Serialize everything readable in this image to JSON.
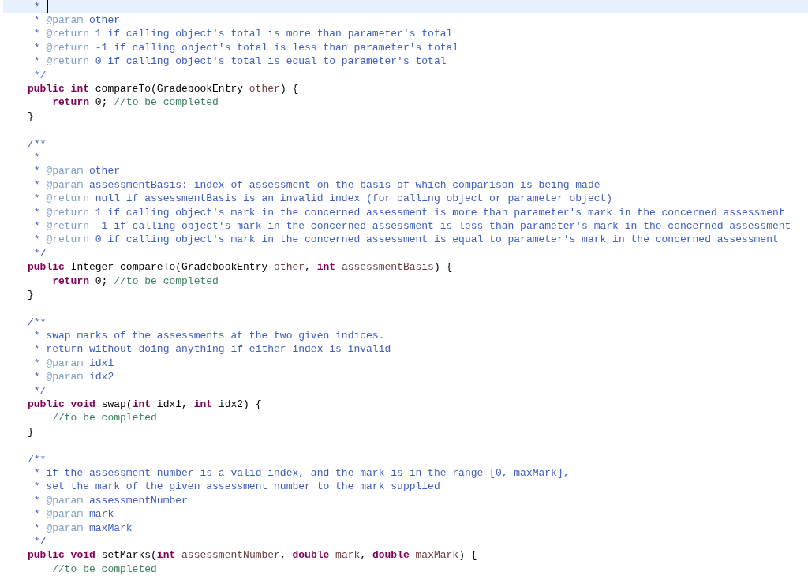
{
  "editor": {
    "lines": [
      {
        "current": true,
        "tokens": [
          {
            "kind": "doc",
            "text": " *"
          }
        ]
      },
      {
        "current": false,
        "tokens": [
          {
            "kind": "doc",
            "text": " * "
          },
          {
            "kind": "tag",
            "text": "@param"
          },
          {
            "kind": "doc",
            "text": " other"
          }
        ]
      },
      {
        "current": false,
        "tokens": [
          {
            "kind": "doc",
            "text": " * "
          },
          {
            "kind": "tag",
            "text": "@return"
          },
          {
            "kind": "doc",
            "text": " 1 if calling object's total is more than parameter's total"
          }
        ]
      },
      {
        "current": false,
        "tokens": [
          {
            "kind": "doc",
            "text": " * "
          },
          {
            "kind": "tag",
            "text": "@return"
          },
          {
            "kind": "doc",
            "text": " -1 if calling object's total is less than parameter's total"
          }
        ]
      },
      {
        "current": false,
        "tokens": [
          {
            "kind": "doc",
            "text": " * "
          },
          {
            "kind": "tag",
            "text": "@return"
          },
          {
            "kind": "doc",
            "text": " 0 if calling object's total is equal to parameter's total"
          }
        ]
      },
      {
        "current": false,
        "tokens": [
          {
            "kind": "doc",
            "text": " */"
          }
        ]
      },
      {
        "current": false,
        "tokens": [
          {
            "kind": "kw",
            "text": "public int"
          },
          {
            "kind": "code",
            "text": " compareTo(GradebookEntry "
          },
          {
            "kind": "param",
            "text": "other"
          },
          {
            "kind": "code",
            "text": ") {"
          }
        ]
      },
      {
        "current": false,
        "tokens": [
          {
            "kind": "kw",
            "text": "    return"
          },
          {
            "kind": "code",
            "text": " 0; "
          },
          {
            "kind": "comment",
            "text": "//to be completed"
          }
        ]
      },
      {
        "current": false,
        "tokens": [
          {
            "kind": "code",
            "text": "}"
          }
        ]
      },
      {
        "current": false
      },
      {
        "current": false,
        "tokens": [
          {
            "kind": "doc",
            "text": "/**"
          }
        ]
      },
      {
        "current": false,
        "tokens": [
          {
            "kind": "doc",
            "text": " *"
          }
        ]
      },
      {
        "current": false,
        "tokens": [
          {
            "kind": "doc",
            "text": " * "
          },
          {
            "kind": "tag",
            "text": "@param"
          },
          {
            "kind": "doc",
            "text": " other"
          }
        ]
      },
      {
        "current": false,
        "tokens": [
          {
            "kind": "doc",
            "text": " * "
          },
          {
            "kind": "tag",
            "text": "@param"
          },
          {
            "kind": "doc",
            "text": " assessmentBasis: index of assessment on the basis of which comparison is being made"
          }
        ]
      },
      {
        "current": false,
        "tokens": [
          {
            "kind": "doc",
            "text": " * "
          },
          {
            "kind": "tag",
            "text": "@return"
          },
          {
            "kind": "doc",
            "text": " null if assessmentBasis is an invalid index (for calling object or parameter object)"
          }
        ]
      },
      {
        "current": false,
        "tokens": [
          {
            "kind": "doc",
            "text": " * "
          },
          {
            "kind": "tag",
            "text": "@return"
          },
          {
            "kind": "doc",
            "text": " 1 if calling object's mark in the concerned assessment is more than parameter's mark in the concerned assessment"
          }
        ]
      },
      {
        "current": false,
        "tokens": [
          {
            "kind": "doc",
            "text": " * "
          },
          {
            "kind": "tag",
            "text": "@return"
          },
          {
            "kind": "doc",
            "text": " -1 if calling object's mark in the concerned assessment is less than parameter's mark in the concerned assessment"
          }
        ]
      },
      {
        "current": false,
        "tokens": [
          {
            "kind": "doc",
            "text": " * "
          },
          {
            "kind": "tag",
            "text": "@return"
          },
          {
            "kind": "doc",
            "text": " 0 if calling object's mark in the concerned assessment is equal to parameter's mark in the concerned assessment"
          }
        ]
      },
      {
        "current": false,
        "tokens": [
          {
            "kind": "doc",
            "text": " */"
          }
        ]
      },
      {
        "current": false,
        "tokens": [
          {
            "kind": "kw",
            "text": "public"
          },
          {
            "kind": "code",
            "text": " Integer compareTo(GradebookEntry "
          },
          {
            "kind": "param",
            "text": "other"
          },
          {
            "kind": "code",
            "text": ", "
          },
          {
            "kind": "kw",
            "text": "int "
          },
          {
            "kind": "param",
            "text": "assessmentBasis"
          },
          {
            "kind": "code",
            "text": ") {"
          }
        ]
      },
      {
        "current": false,
        "tokens": [
          {
            "kind": "kw",
            "text": "    return"
          },
          {
            "kind": "code",
            "text": " 0; "
          },
          {
            "kind": "comment",
            "text": "//to be completed"
          }
        ]
      },
      {
        "current": false,
        "tokens": [
          {
            "kind": "code",
            "text": "}"
          }
        ]
      },
      {
        "current": false
      },
      {
        "current": false,
        "tokens": [
          {
            "kind": "doc",
            "text": "/**"
          }
        ]
      },
      {
        "current": false,
        "tokens": [
          {
            "kind": "doc",
            "text": " * swap marks of the assessments at the two given indices."
          }
        ]
      },
      {
        "current": false,
        "tokens": [
          {
            "kind": "doc",
            "text": " * return without doing anything if either index is invalid"
          }
        ]
      },
      {
        "current": false,
        "tokens": [
          {
            "kind": "doc",
            "text": " * "
          },
          {
            "kind": "tag",
            "text": "@param"
          },
          {
            "kind": "doc",
            "text": " idx1"
          }
        ]
      },
      {
        "current": false,
        "tokens": [
          {
            "kind": "doc",
            "text": " * "
          },
          {
            "kind": "tag",
            "text": "@param"
          },
          {
            "kind": "doc",
            "text": " idx2"
          }
        ]
      },
      {
        "current": false,
        "tokens": [
          {
            "kind": "doc",
            "text": " */"
          }
        ]
      },
      {
        "current": false,
        "tokens": [
          {
            "kind": "kw",
            "text": "public void"
          },
          {
            "kind": "code",
            "text": " swap("
          },
          {
            "kind": "kw",
            "text": "int"
          },
          {
            "kind": "code",
            "text": " idx1, "
          },
          {
            "kind": "kw",
            "text": "int"
          },
          {
            "kind": "code",
            "text": " idx2) {"
          }
        ]
      },
      {
        "current": false,
        "tokens": [
          {
            "kind": "comment",
            "text": "    //to be completed"
          }
        ]
      },
      {
        "current": false,
        "tokens": [
          {
            "kind": "code",
            "text": "}"
          }
        ]
      },
      {
        "current": false
      },
      {
        "current": false,
        "tokens": [
          {
            "kind": "doc",
            "text": "/**"
          }
        ]
      },
      {
        "current": false,
        "tokens": [
          {
            "kind": "doc",
            "text": " * if the assessment number is a valid index, and the mark is in the range [0, maxMark],"
          }
        ]
      },
      {
        "current": false,
        "tokens": [
          {
            "kind": "doc",
            "text": " * set the mark of the given assessment number to the mark supplied"
          }
        ]
      },
      {
        "current": false,
        "tokens": [
          {
            "kind": "doc",
            "text": " * "
          },
          {
            "kind": "tag",
            "text": "@param"
          },
          {
            "kind": "doc",
            "text": " assessmentNumber"
          }
        ]
      },
      {
        "current": false,
        "tokens": [
          {
            "kind": "doc",
            "text": " * "
          },
          {
            "kind": "tag",
            "text": "@param"
          },
          {
            "kind": "doc",
            "text": " mark"
          }
        ]
      },
      {
        "current": false,
        "tokens": [
          {
            "kind": "doc",
            "text": " * "
          },
          {
            "kind": "tag",
            "text": "@param"
          },
          {
            "kind": "doc",
            "text": " maxMark"
          }
        ]
      },
      {
        "current": false,
        "tokens": [
          {
            "kind": "doc",
            "text": " */"
          }
        ]
      },
      {
        "current": false,
        "tokens": [
          {
            "kind": "kw",
            "text": "public void"
          },
          {
            "kind": "code",
            "text": " setMarks("
          },
          {
            "kind": "kw",
            "text": "int "
          },
          {
            "kind": "param",
            "text": "assessmentNumber"
          },
          {
            "kind": "code",
            "text": ", "
          },
          {
            "kind": "kw",
            "text": "double "
          },
          {
            "kind": "param",
            "text": "mark"
          },
          {
            "kind": "code",
            "text": ", "
          },
          {
            "kind": "kw",
            "text": "double "
          },
          {
            "kind": "param",
            "text": "maxMark"
          },
          {
            "kind": "code",
            "text": ") {"
          }
        ]
      },
      {
        "current": false,
        "tokens": [
          {
            "kind": "comment",
            "text": "    //to be completed"
          }
        ]
      }
    ]
  }
}
